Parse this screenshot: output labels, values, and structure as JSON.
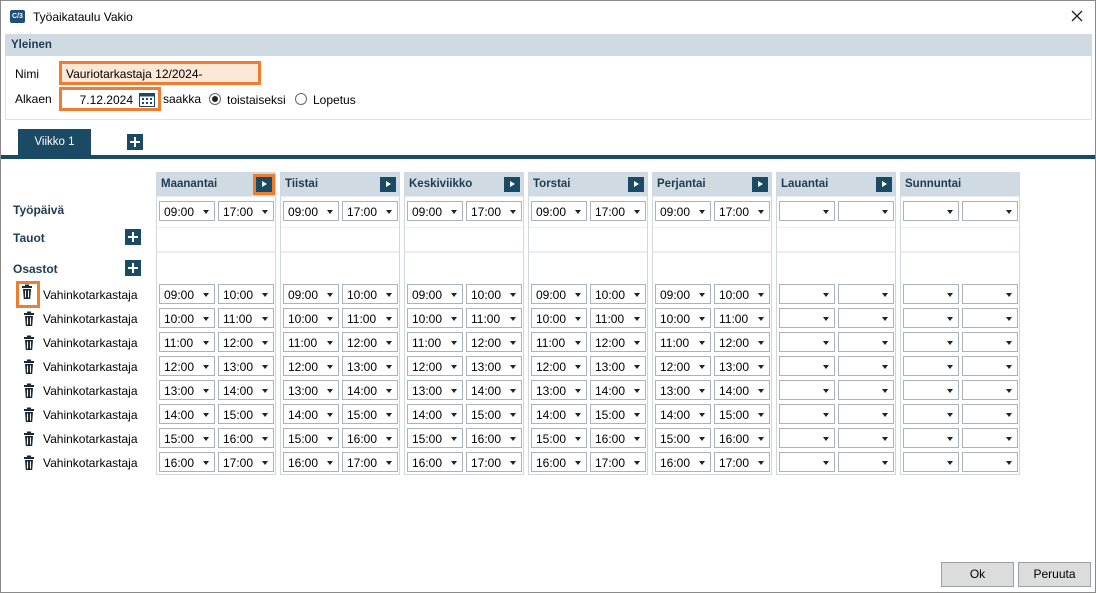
{
  "window": {
    "title": "Työaikataulu Vakio",
    "icon": "app-icon",
    "icon_text": "C/3"
  },
  "general": {
    "section_title": "Yleinen",
    "name_label": "Nimi",
    "name_value": "Vauriotarkastaja 12/2024-",
    "start_label": "Alkaen",
    "start_value": "7.12.2024",
    "until_label": "saakka",
    "radio_indefinite": "toistaiseksi",
    "radio_end": "Lopetus",
    "selected_radio": "toistaiseksi"
  },
  "tabs": [
    {
      "label": "Viikko 1",
      "active": true
    }
  ],
  "rows": {
    "workday": "Työpäivä",
    "breaks": "Tauot",
    "departments": "Osastot"
  },
  "departments": [
    "Vahinkotarkastaja",
    "Vahinkotarkastaja",
    "Vahinkotarkastaja",
    "Vahinkotarkastaja",
    "Vahinkotarkastaja",
    "Vahinkotarkastaja",
    "Vahinkotarkastaja",
    "Vahinkotarkastaja"
  ],
  "days": [
    {
      "name": "Maanantai",
      "workday": [
        "09:00",
        "17:00"
      ],
      "slots": [
        [
          "09:00",
          "10:00"
        ],
        [
          "10:00",
          "11:00"
        ],
        [
          "11:00",
          "12:00"
        ],
        [
          "12:00",
          "13:00"
        ],
        [
          "13:00",
          "14:00"
        ],
        [
          "14:00",
          "15:00"
        ],
        [
          "15:00",
          "16:00"
        ],
        [
          "16:00",
          "17:00"
        ]
      ]
    },
    {
      "name": "Tiistai",
      "workday": [
        "09:00",
        "17:00"
      ],
      "slots": [
        [
          "09:00",
          "10:00"
        ],
        [
          "10:00",
          "11:00"
        ],
        [
          "11:00",
          "12:00"
        ],
        [
          "12:00",
          "13:00"
        ],
        [
          "13:00",
          "14:00"
        ],
        [
          "14:00",
          "15:00"
        ],
        [
          "15:00",
          "16:00"
        ],
        [
          "16:00",
          "17:00"
        ]
      ]
    },
    {
      "name": "Keskiviikko",
      "workday": [
        "09:00",
        "17:00"
      ],
      "slots": [
        [
          "09:00",
          "10:00"
        ],
        [
          "10:00",
          "11:00"
        ],
        [
          "11:00",
          "12:00"
        ],
        [
          "12:00",
          "13:00"
        ],
        [
          "13:00",
          "14:00"
        ],
        [
          "14:00",
          "15:00"
        ],
        [
          "15:00",
          "16:00"
        ],
        [
          "16:00",
          "17:00"
        ]
      ]
    },
    {
      "name": "Torstai",
      "workday": [
        "09:00",
        "17:00"
      ],
      "slots": [
        [
          "09:00",
          "10:00"
        ],
        [
          "10:00",
          "11:00"
        ],
        [
          "11:00",
          "12:00"
        ],
        [
          "12:00",
          "13:00"
        ],
        [
          "13:00",
          "14:00"
        ],
        [
          "14:00",
          "15:00"
        ],
        [
          "15:00",
          "16:00"
        ],
        [
          "16:00",
          "17:00"
        ]
      ]
    },
    {
      "name": "Perjantai",
      "workday": [
        "09:00",
        "17:00"
      ],
      "slots": [
        [
          "09:00",
          "10:00"
        ],
        [
          "10:00",
          "11:00"
        ],
        [
          "11:00",
          "12:00"
        ],
        [
          "12:00",
          "13:00"
        ],
        [
          "13:00",
          "14:00"
        ],
        [
          "14:00",
          "15:00"
        ],
        [
          "15:00",
          "16:00"
        ],
        [
          "16:00",
          "17:00"
        ]
      ]
    },
    {
      "name": "Lauantai",
      "workday": [
        "",
        ""
      ],
      "slots": [
        [
          "",
          ""
        ],
        [
          "",
          ""
        ],
        [
          "",
          ""
        ],
        [
          "",
          ""
        ],
        [
          "",
          ""
        ],
        [
          "",
          ""
        ],
        [
          "",
          ""
        ],
        [
          "",
          ""
        ]
      ]
    },
    {
      "name": "Sunnuntai",
      "workday": [
        "",
        ""
      ],
      "slots": [
        [
          "",
          ""
        ],
        [
          "",
          ""
        ],
        [
          "",
          ""
        ],
        [
          "",
          ""
        ],
        [
          "",
          ""
        ],
        [
          "",
          ""
        ],
        [
          "",
          ""
        ],
        [
          "",
          ""
        ]
      ]
    }
  ],
  "buttons": {
    "ok": "Ok",
    "cancel": "Peruuta"
  },
  "colors": {
    "accent": "#1b4a64",
    "highlight": "#ed7d31",
    "header": "#cfdae3"
  }
}
